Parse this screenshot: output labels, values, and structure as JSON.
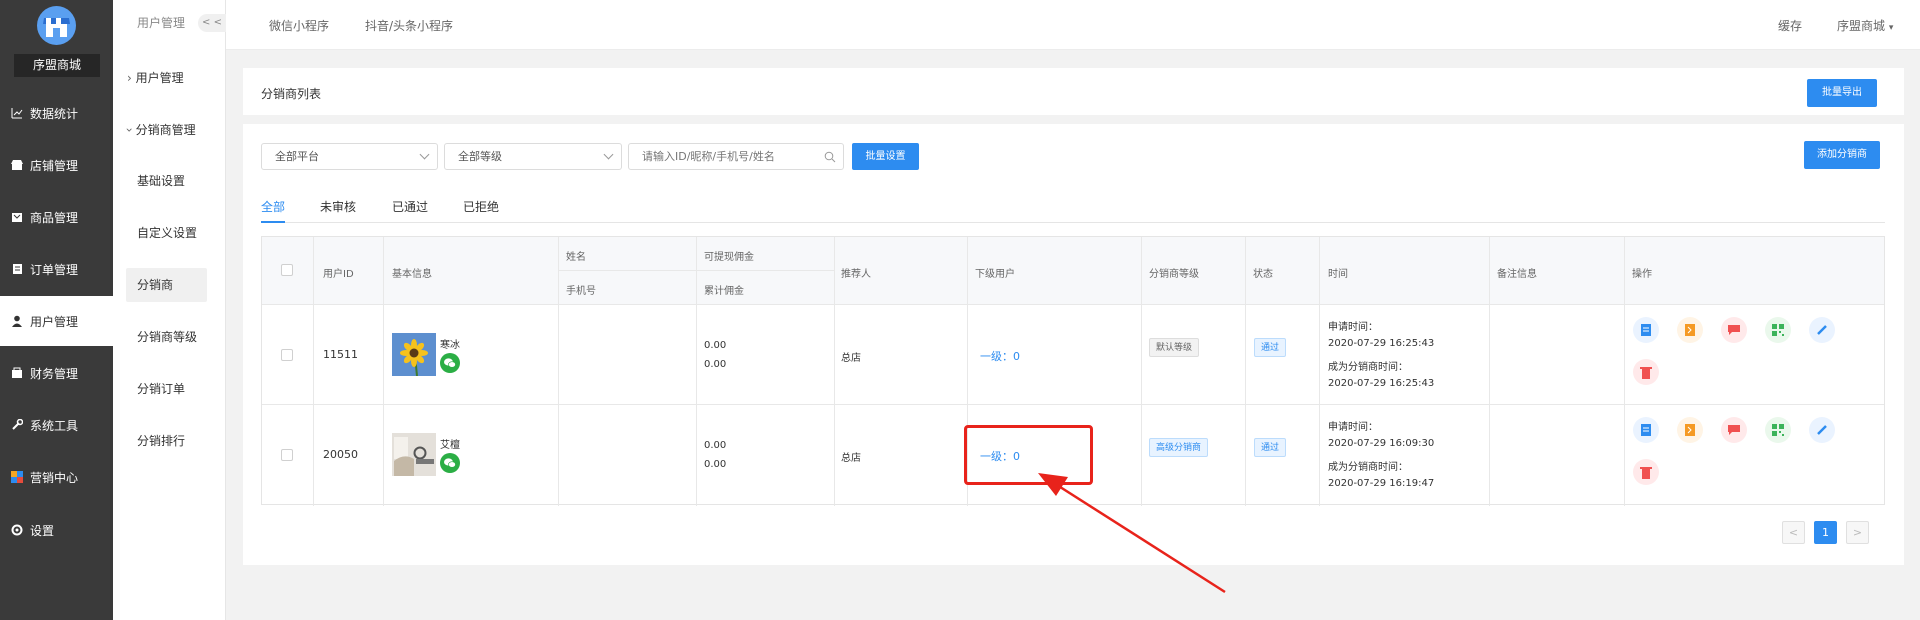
{
  "sidebar": {
    "shop_name": "序盟商城",
    "items": [
      {
        "label": "数据统计",
        "icon": "chart-icon"
      },
      {
        "label": "店铺管理",
        "icon": "store-icon"
      },
      {
        "label": "商品管理",
        "icon": "goods-icon"
      },
      {
        "label": "订单管理",
        "icon": "order-icon"
      },
      {
        "label": "用户管理",
        "icon": "user-icon"
      },
      {
        "label": "财务管理",
        "icon": "finance-icon"
      },
      {
        "label": "系统工具",
        "icon": "wrench-icon"
      },
      {
        "label": "营销中心",
        "icon": "marketing-icon"
      },
      {
        "label": "设置",
        "icon": "gear-icon"
      }
    ]
  },
  "subnav": {
    "title": "用户管理",
    "collapse": "< <",
    "groups": [
      "用户管理",
      "分销商管理"
    ],
    "items": [
      "基础设置",
      "自定义设置",
      "分销商",
      "分销商等级",
      "分销订单",
      "分销排行"
    ]
  },
  "topbar": {
    "tabs": [
      "微信小程序",
      "抖音/头条小程序"
    ],
    "cache": "缓存",
    "account": "序盟商城"
  },
  "header": {
    "title": "分销商列表",
    "export": "批量导出"
  },
  "filters": {
    "platform": "全部平台",
    "level": "全部等级",
    "search_placeholder": "请输入ID/昵称/手机号/姓名",
    "batch": "批量设置",
    "add": "添加分销商"
  },
  "tabs": [
    "全部",
    "未审核",
    "已通过",
    "已拒绝"
  ],
  "table": {
    "headers": {
      "uid": "用户ID",
      "basic": "基本信息",
      "name": "姓名",
      "phone": "手机号",
      "withdrawable": "可提现佣金",
      "total": "累计佣金",
      "referrer": "推荐人",
      "sub": "下级用户",
      "level": "分销商等级",
      "status": "状态",
      "time": "时间",
      "remark": "备注信息",
      "ops": "操作"
    },
    "rows": [
      {
        "uid": "11511",
        "nick": "寒冰",
        "withdrawable": "0.00",
        "total": "0.00",
        "referrer": "总店",
        "sub": "一级：0",
        "level": "默认等级",
        "status": "通过",
        "apply_label": "申请时间：",
        "apply_time": "2020-07-29 16:25:43",
        "become_label": "成为分销商时间：",
        "become_time": "2020-07-29 16:25:43"
      },
      {
        "uid": "20050",
        "nick": "艾檀",
        "withdrawable": "0.00",
        "total": "0.00",
        "referrer": "总店",
        "sub": "一级：0",
        "level": "高级分销商",
        "status": "通过",
        "apply_label": "申请时间：",
        "apply_time": "2020-07-29 16:09:30",
        "become_label": "成为分销商时间：",
        "become_time": "2020-07-29 16:19:47"
      }
    ]
  },
  "pagination": {
    "prev": "<",
    "current": "1",
    "next": ">"
  },
  "colors": {
    "accent": "#2d8cf0",
    "sidebar": "#3a3a3a",
    "annotation": "#e8231b"
  }
}
